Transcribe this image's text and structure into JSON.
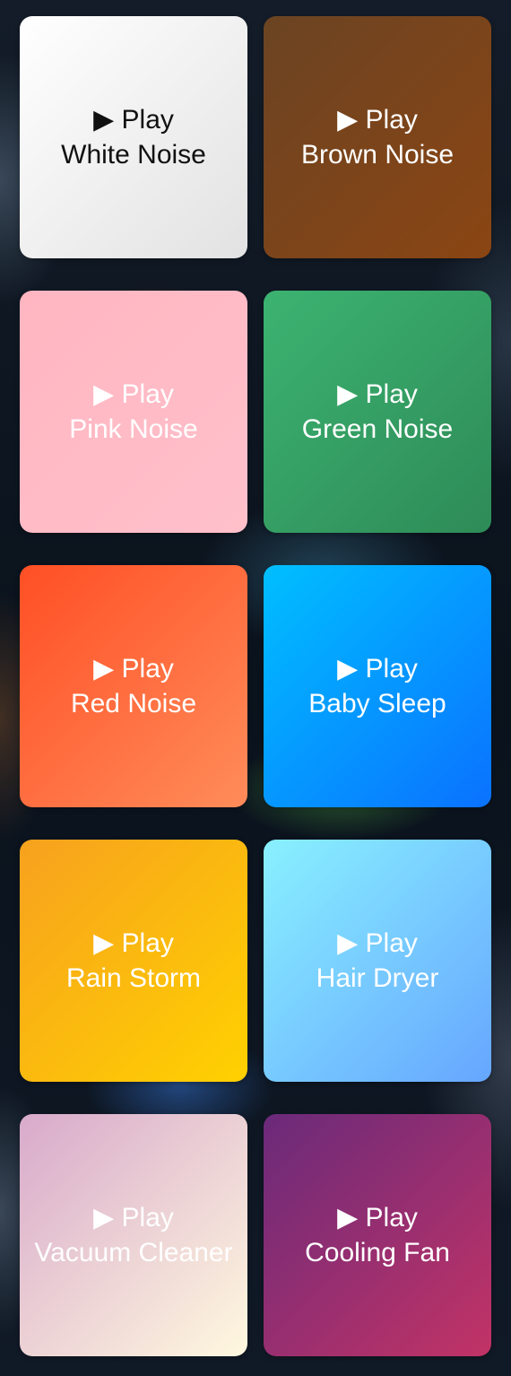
{
  "tiles": [
    {
      "id": "white-noise",
      "play_label": "▶ Play",
      "name": "White Noise"
    },
    {
      "id": "brown-noise",
      "play_label": "▶ Play",
      "name": "Brown Noise"
    },
    {
      "id": "pink-noise",
      "play_label": "▶ Play",
      "name": "Pink Noise"
    },
    {
      "id": "green-noise",
      "play_label": "▶ Play",
      "name": "Green Noise"
    },
    {
      "id": "red-noise",
      "play_label": "▶ Play",
      "name": "Red Noise"
    },
    {
      "id": "baby-sleep",
      "play_label": "▶ Play",
      "name": "Baby Sleep"
    },
    {
      "id": "rain-storm",
      "play_label": "▶ Play",
      "name": "Rain Storm"
    },
    {
      "id": "hair-dryer",
      "play_label": "▶ Play",
      "name": "Hair Dryer"
    },
    {
      "id": "vacuum-cleaner",
      "play_label": "▶ Play",
      "name": "Vacuum Cleaner"
    },
    {
      "id": "cooling-fan",
      "play_label": "▶ Play",
      "name": "Cooling Fan"
    }
  ],
  "colors": {
    "white_noise": [
      "#ffffff",
      "#e2e2e2"
    ],
    "brown_noise": [
      "#6b4423",
      "#8b4513"
    ],
    "pink_noise": [
      "#ffb6c1",
      "#ffc0cb"
    ],
    "green_noise": [
      "#3cb371",
      "#2e8b57"
    ],
    "red_noise": [
      "#ff4f25",
      "#ff8c5a"
    ],
    "baby_sleep": [
      "#00bfff",
      "#0a72ff"
    ],
    "rain_storm": [
      "#f7a11e",
      "#ffd100"
    ],
    "hair_dryer": [
      "#89f1ff",
      "#66a6ff"
    ],
    "vacuum_cleaner": [
      "#d8aacb",
      "#fff8df"
    ],
    "cooling_fan": [
      "#6a2a7a",
      "#c23366"
    ]
  }
}
